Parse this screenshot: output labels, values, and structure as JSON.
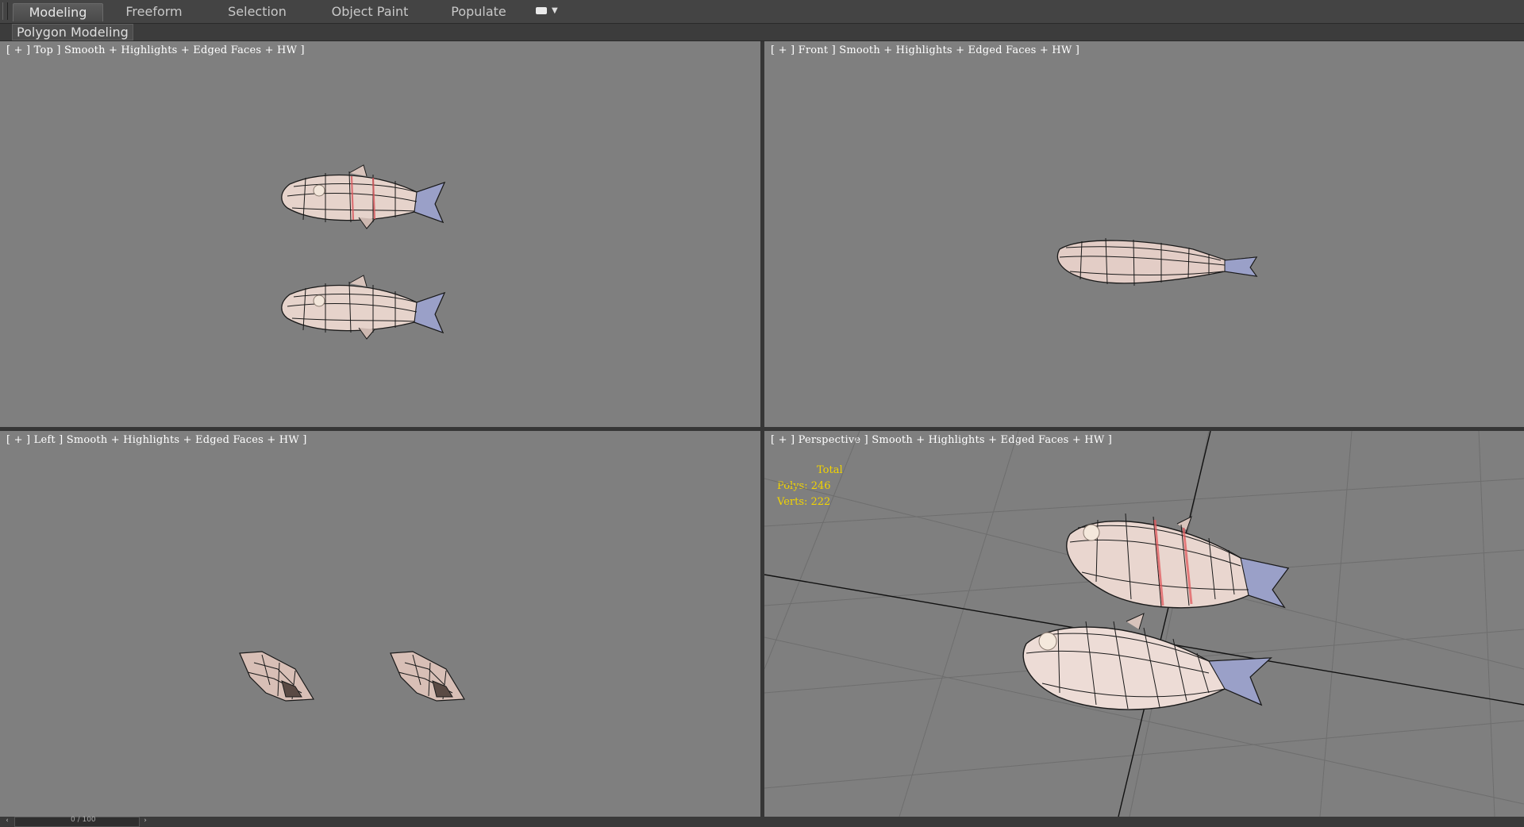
{
  "ribbon": {
    "tabs": [
      {
        "label": "Modeling",
        "active": true
      },
      {
        "label": "Freeform",
        "active": false
      },
      {
        "label": "Selection",
        "active": false
      },
      {
        "label": "Object Paint",
        "active": false
      },
      {
        "label": "Populate",
        "active": false
      }
    ],
    "options_icon": "eye-toggle-icon",
    "panel_label": "Polygon Modeling"
  },
  "viewports": {
    "top": {
      "label": "[ + ] Top ] Smooth + Highlights + Edged Faces + HW ]"
    },
    "front": {
      "label": "[ + ] Front ] Smooth + Highlights + Edged Faces + HW ]"
    },
    "left": {
      "label": "[ + ] Left ] Smooth + Highlights + Edged Faces + HW ]"
    },
    "perspective": {
      "label": "[ + ] Perspective ] Smooth + Highlights + Edged Faces + HW ]",
      "stats": {
        "title": "Total",
        "polys": "Polys: 246",
        "verts": "Verts: 222"
      }
    }
  },
  "timeline": {
    "frame": "0 / 100"
  },
  "colors": {
    "viewport_bg": "#7f7f7f",
    "stats_text": "#f2d400",
    "mesh_body": "#e9d6cf",
    "mesh_tail": "#9aa0c8",
    "mesh_stripe": "#d95a5a"
  }
}
